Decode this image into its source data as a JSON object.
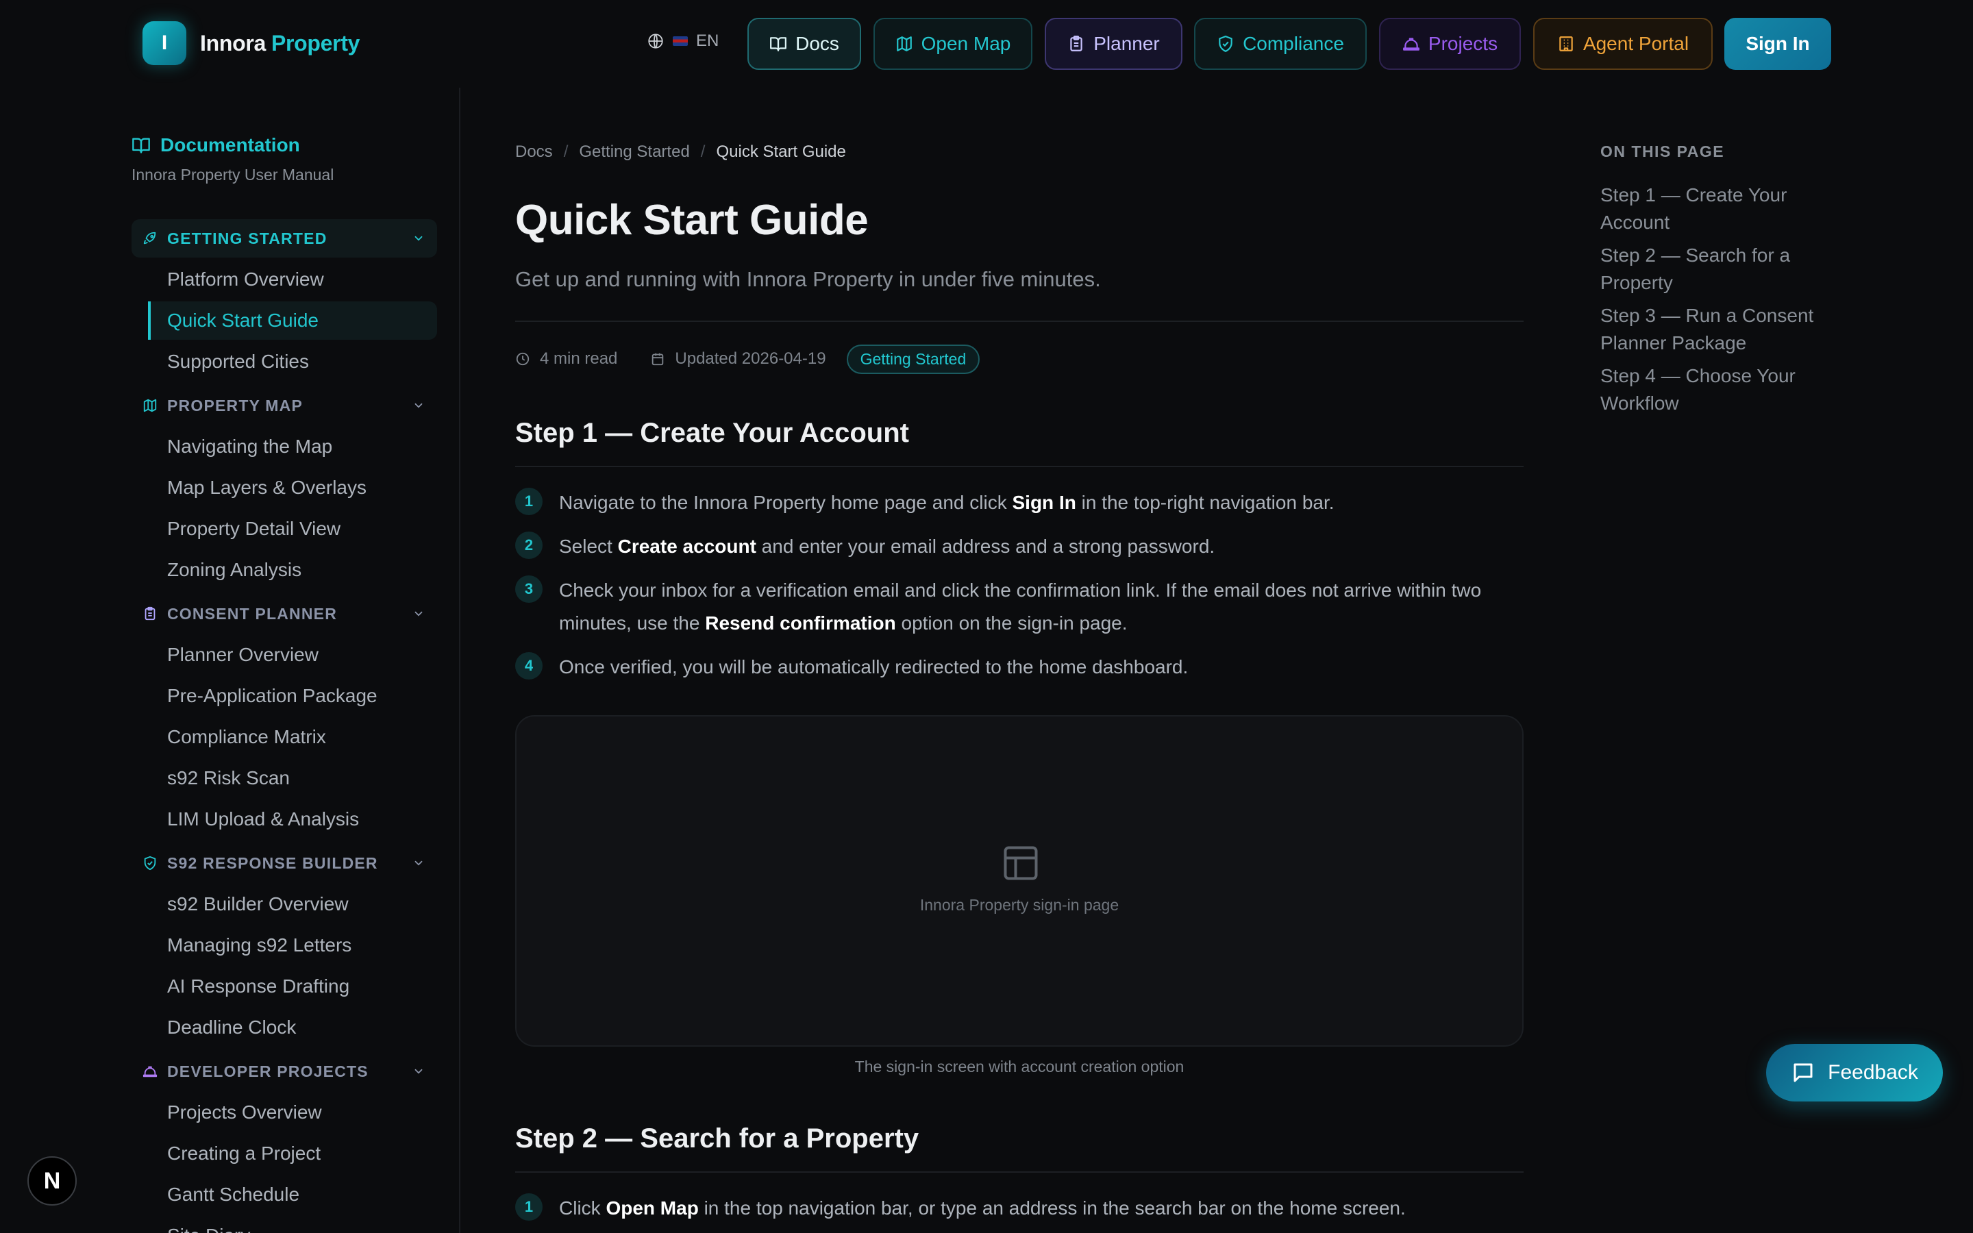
{
  "brand": {
    "mark": "I",
    "name_1": "Innora",
    "name_2": "Property"
  },
  "lang": {
    "flag": "uk-flag",
    "code": "EN"
  },
  "nav": {
    "docs": "Docs",
    "open_map": "Open Map",
    "planner": "Planner",
    "compliance": "Compliance",
    "projects": "Projects",
    "agent_portal": "Agent Portal",
    "sign_in": "Sign In"
  },
  "sidebar": {
    "title": "Documentation",
    "subtitle": "Innora Property User Manual",
    "sections": [
      {
        "label": "GETTING STARTED",
        "icon": "rocket-icon",
        "items": [
          "Platform Overview",
          "Quick Start Guide",
          "Supported Cities"
        ]
      },
      {
        "label": "PROPERTY MAP",
        "icon": "map-icon",
        "items": [
          "Navigating the Map",
          "Map Layers & Overlays",
          "Property Detail View",
          "Zoning Analysis"
        ]
      },
      {
        "label": "CONSENT PLANNER",
        "icon": "clipboard-icon",
        "items": [
          "Planner Overview",
          "Pre-Application Package",
          "Compliance Matrix",
          "s92 Risk Scan",
          "LIM Upload & Analysis"
        ]
      },
      {
        "label": "S92 RESPONSE BUILDER",
        "icon": "shield-icon",
        "items": [
          "s92 Builder Overview",
          "Managing s92 Letters",
          "AI Response Drafting",
          "Deadline Clock"
        ]
      },
      {
        "label": "DEVELOPER PROJECTS",
        "icon": "hardhat-icon",
        "items": [
          "Projects Overview",
          "Creating a Project",
          "Gantt Schedule",
          "Site Diary"
        ]
      }
    ],
    "active_item": "Quick Start Guide"
  },
  "breadcrumb": [
    "Docs",
    "Getting Started",
    "Quick Start Guide"
  ],
  "page": {
    "title": "Quick Start Guide",
    "subtitle": "Get up and running with Innora Property in under five minutes.",
    "read_time": "4 min read",
    "updated": "Updated 2026-04-19",
    "tag": "Getting Started"
  },
  "step1": {
    "heading": "Step 1 — Create Your Account",
    "items": [
      {
        "n": "1",
        "pre": "Navigate to the Innora Property home page and click ",
        "bold": "Sign In",
        "post": " in the top-right navigation bar."
      },
      {
        "n": "2",
        "pre": "Select ",
        "bold": "Create account",
        "post": " and enter your email address and a strong password."
      },
      {
        "n": "3",
        "pre": "Check your inbox for a verification email and click the confirmation link. If the email does not arrive within two minutes, use the ",
        "bold": "Resend confirmation",
        "post": " option on the sign-in page."
      },
      {
        "n": "4",
        "pre": "Once verified, you will be automatically redirected to the home dashboard.",
        "bold": "",
        "post": ""
      }
    ],
    "figure_label": "Innora Property sign-in page",
    "figure_caption": "The sign-in screen with account creation option"
  },
  "step2": {
    "heading": "Step 2 — Search for a Property",
    "items": [
      {
        "n": "1",
        "pre": "Click ",
        "bold": "Open Map",
        "post": " in the top navigation bar, or type an address in the search bar on the home screen."
      }
    ]
  },
  "toc": {
    "title": "ON THIS PAGE",
    "items": [
      "Step 1 — Create Your Account",
      "Step 2 — Search for a Property",
      "Step 3 — Run a Consent Planner Package",
      "Step 4 — Choose Your Workflow"
    ]
  },
  "feedback": "Feedback",
  "dev_badge": "N",
  "colors": {
    "accent": "#22c7cf",
    "background": "#0b0c0e",
    "planner": "#c9c3ff",
    "projects": "#9a5cf0",
    "agent": "#f0a43a"
  }
}
